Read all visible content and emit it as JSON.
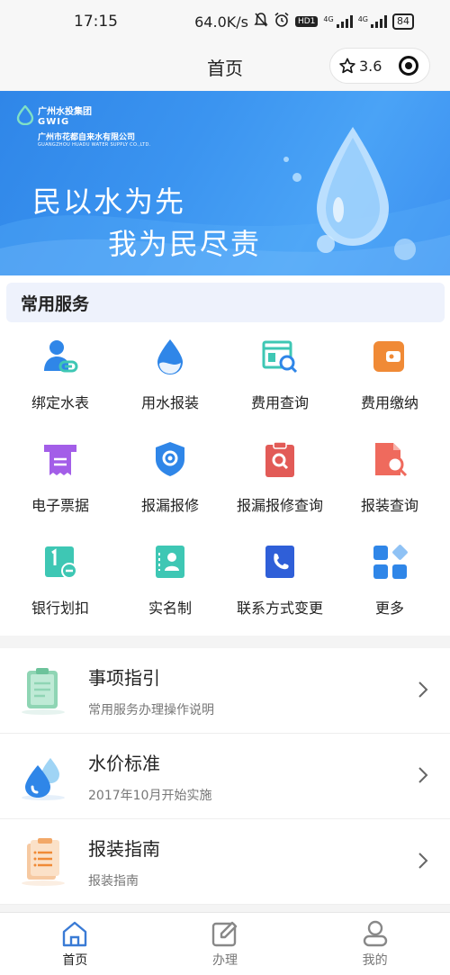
{
  "status": {
    "time": "17:15",
    "speed": "64.0K/s",
    "battery": "84",
    "net1": "4G",
    "net2": "4G",
    "hd": "HD1"
  },
  "nav": {
    "title": "首页",
    "rating": "3.6"
  },
  "banner": {
    "logo_line1": "广州水投集团",
    "logo_line2": "GWIG",
    "logo_line3": "广州市花都自来水有限公司",
    "logo_line4": "GUANGZHOU HUADU WATER SUPPLY CO.,LTD.",
    "slogan1": "民以水为先",
    "slogan2": "我为民尽责"
  },
  "services": {
    "title": "常用服务",
    "items": [
      {
        "label": "绑定水表",
        "icon": "user-link-icon"
      },
      {
        "label": "用水报装",
        "icon": "water-drop-icon"
      },
      {
        "label": "费用查询",
        "icon": "bill-search-icon"
      },
      {
        "label": "费用缴纳",
        "icon": "wallet-icon"
      },
      {
        "label": "电子票据",
        "icon": "receipt-icon"
      },
      {
        "label": "报漏报修",
        "icon": "shield-gear-icon"
      },
      {
        "label": "报漏报修查询",
        "icon": "clipboard-search-icon"
      },
      {
        "label": "报装查询",
        "icon": "document-search-icon"
      },
      {
        "label": "银行划扣",
        "icon": "bank-card-icon"
      },
      {
        "label": "实名制",
        "icon": "id-contact-icon"
      },
      {
        "label": "联系方式变更",
        "icon": "phone-book-icon"
      },
      {
        "label": "更多",
        "icon": "more-grid-icon"
      }
    ]
  },
  "list": [
    {
      "title": "事项指引",
      "subtitle": "常用服务办理操作说明",
      "icon": "clipboard-guide-icon"
    },
    {
      "title": "水价标准",
      "subtitle": "2017年10月开始实施",
      "icon": "water-drops-icon"
    },
    {
      "title": "报装指南",
      "subtitle": "报装指南",
      "icon": "document-guide-icon"
    }
  ],
  "tabs": [
    {
      "label": "首页",
      "icon": "home-icon",
      "active": true
    },
    {
      "label": "办理",
      "icon": "edit-icon",
      "active": false
    },
    {
      "label": "我的",
      "icon": "profile-icon",
      "active": false
    }
  ],
  "colors": {
    "accent": "#2f86e8",
    "tab_active": "#3a7bd5",
    "icon_gray": "#888888"
  }
}
